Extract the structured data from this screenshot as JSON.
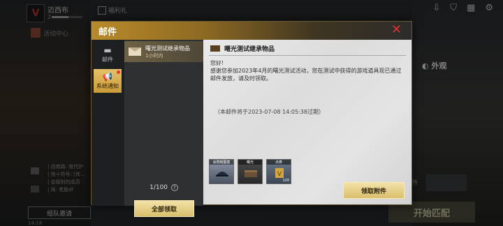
{
  "profile": {
    "name": "迈西布",
    "level": "2",
    "level_progress": 0.55
  },
  "top": {
    "gift_label": "福利礼"
  },
  "nav": {
    "activity_label": "活动中心"
  },
  "top_icons": [
    "download-icon",
    "shield-icon",
    "grid-icon",
    "gear-icon"
  ],
  "outlook": {
    "label": "外观"
  },
  "chat": {
    "lines": [
      "| 店南路: 就代护",
      "| 快十符号: [传...",
      "| 会级别的成员",
      "| 局: 老股df"
    ]
  },
  "team": {
    "invite_label": "组队邀请",
    "time": "14:18"
  },
  "match": {
    "start_label": "开始匹配"
  },
  "right_partial": {
    "label": "所"
  },
  "dialog": {
    "title": "邮件",
    "categories": [
      {
        "label": "邮件",
        "active": false
      },
      {
        "label": "系统通知",
        "active": true
      }
    ],
    "mail": {
      "title": "曙光测试继承物品",
      "time": "1小时内"
    },
    "count": "1/100",
    "claim_all_label": "全部领取",
    "content": {
      "heading": "曙光测试继承物品",
      "greeting": "您好!",
      "body": "感谢您参加2023年4月的曙光测试活动，您在测试中获得的游戏道具现已通过邮件发放，请及时领取。",
      "expire": "（本邮件将于2023-07-08 14:05:38过期）",
      "items": [
        {
          "label": "涂鸦帽图案",
          "qty": ""
        },
        {
          "label": "曙光",
          "qty": ""
        },
        {
          "label": "点券",
          "qty": "120"
        }
      ],
      "claim_label": "领取附件"
    }
  }
}
